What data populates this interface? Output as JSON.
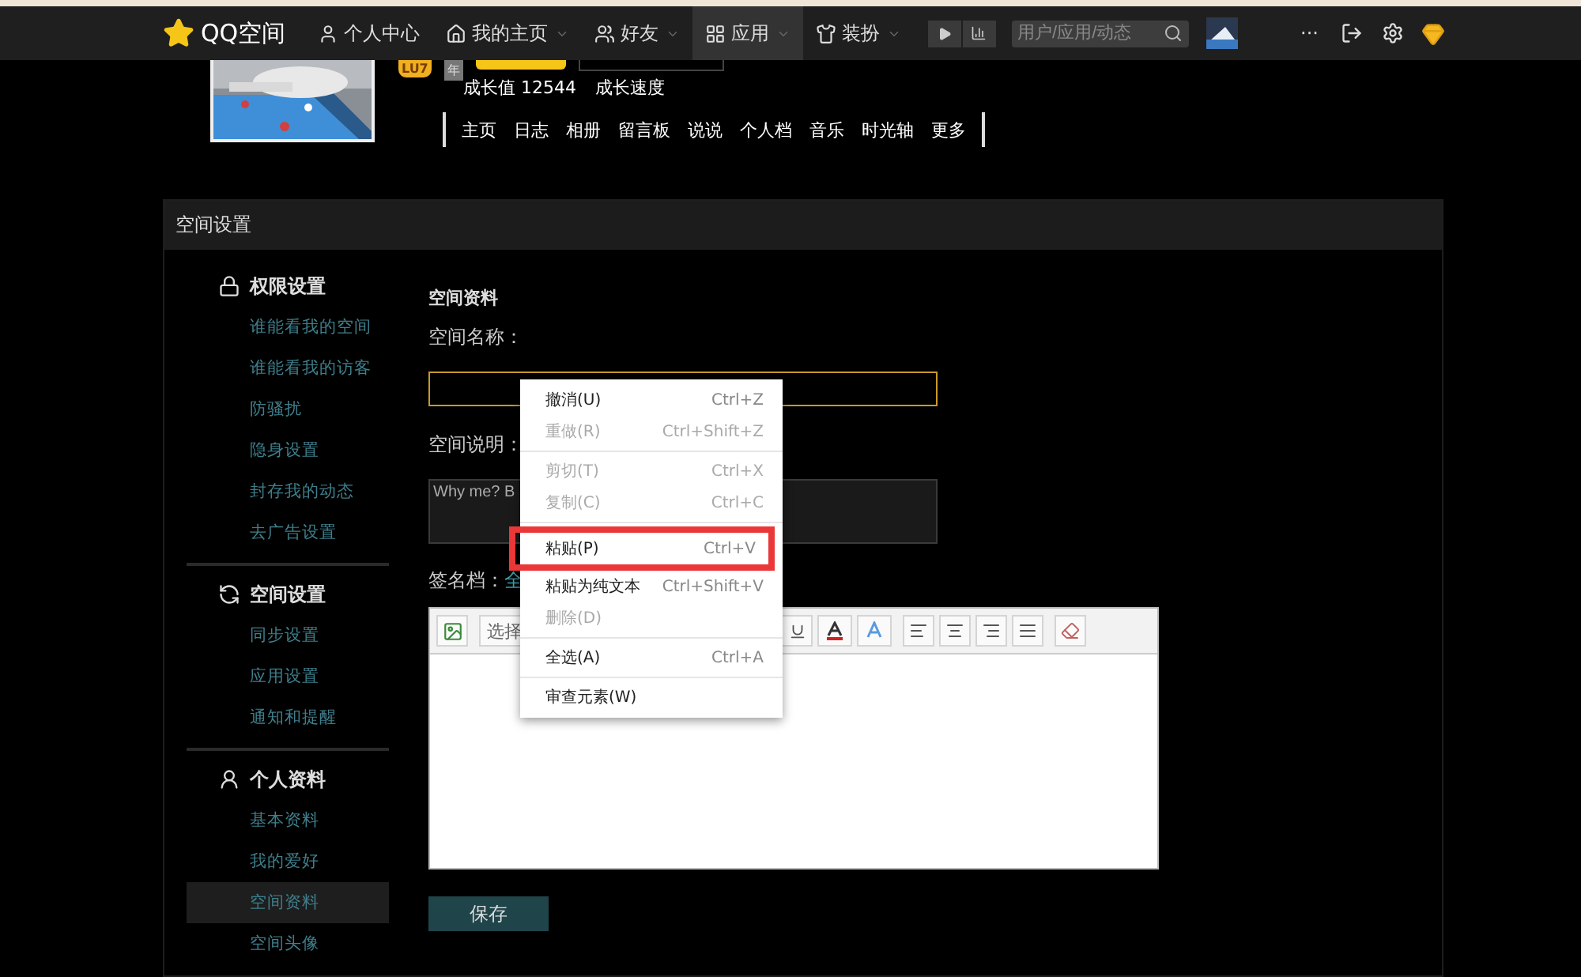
{
  "top_nav": {
    "logo": "QQ空间",
    "items": [
      {
        "label": "个人中心",
        "selected": false,
        "dropdown": false
      },
      {
        "label": "我的主页",
        "selected": false,
        "dropdown": true
      },
      {
        "label": "好友",
        "selected": false,
        "dropdown": true
      },
      {
        "label": "应用",
        "selected": true,
        "dropdown": true
      },
      {
        "label": "装扮",
        "selected": false,
        "dropdown": true
      }
    ],
    "search": {
      "placeholder": "用户/应用/动态"
    },
    "more": "···"
  },
  "profile": {
    "level_badge": "LU7",
    "year_badge": "年",
    "growth": "成长值 12544",
    "speed": "成长速度",
    "tabs": [
      "主页",
      "日志",
      "相册",
      "留言板",
      "说说",
      "个人档",
      "音乐",
      "时光轴",
      "更多"
    ]
  },
  "panel": {
    "title": "空间设置",
    "sidebar": [
      {
        "title": "权限设置",
        "items": [
          {
            "label": "谁能看我的空间",
            "selected": false
          },
          {
            "label": "谁能看我的访客",
            "selected": false
          },
          {
            "label": "防骚扰",
            "selected": false
          },
          {
            "label": "隐身设置",
            "selected": false
          },
          {
            "label": "封存我的动态",
            "selected": false
          },
          {
            "label": "去广告设置",
            "selected": false
          }
        ]
      },
      {
        "title": "空间设置",
        "items": [
          {
            "label": "同步设置",
            "selected": false
          },
          {
            "label": "应用设置",
            "selected": false
          },
          {
            "label": "通知和提醒",
            "selected": false
          }
        ]
      },
      {
        "title": "个人资料",
        "items": [
          {
            "label": "基本资料",
            "selected": false
          },
          {
            "label": "我的爱好",
            "selected": false
          },
          {
            "label": "空间资料",
            "selected": true
          },
          {
            "label": "空间头像",
            "selected": false
          }
        ]
      }
    ],
    "form": {
      "heading": "空间资料",
      "name_label": "空间名称：",
      "name_field": {
        "focused": true
      },
      "description_label": "空间说明：",
      "description_field": {
        "value": "Why me? B"
      },
      "signature_label": "签名档：",
      "signature_link": "全",
      "editor": {
        "font_select": "选择"
      },
      "save_button": "保存"
    }
  },
  "context_menu": [
    {
      "kind": "item",
      "label": "撤消(U)",
      "shortcut": "Ctrl+Z",
      "disabled": false,
      "marked": false
    },
    {
      "kind": "item",
      "label": "重做(R)",
      "shortcut": "Ctrl+Shift+Z",
      "disabled": true,
      "marked": false
    },
    {
      "kind": "separator"
    },
    {
      "kind": "item",
      "label": "剪切(T)",
      "shortcut": "Ctrl+X",
      "disabled": true,
      "marked": false
    },
    {
      "kind": "item",
      "label": "复制(C)",
      "shortcut": "Ctrl+C",
      "disabled": true,
      "marked": false
    },
    {
      "kind": "separator"
    },
    {
      "kind": "item",
      "label": "粘贴(P)",
      "shortcut": "Ctrl+V",
      "disabled": false,
      "marked": true
    },
    {
      "kind": "item",
      "label": "粘贴为纯文本",
      "shortcut": "Ctrl+Shift+V",
      "disabled": false,
      "marked": false
    },
    {
      "kind": "item",
      "label": "删除(D)",
      "disabled": true,
      "marked": false
    },
    {
      "kind": "separator"
    },
    {
      "kind": "item",
      "label": "全选(A)",
      "shortcut": "Ctrl+A",
      "disabled": false,
      "marked": false
    },
    {
      "kind": "separator"
    },
    {
      "kind": "item",
      "label": "审查元素(W)",
      "disabled": false,
      "marked": false
    }
  ]
}
